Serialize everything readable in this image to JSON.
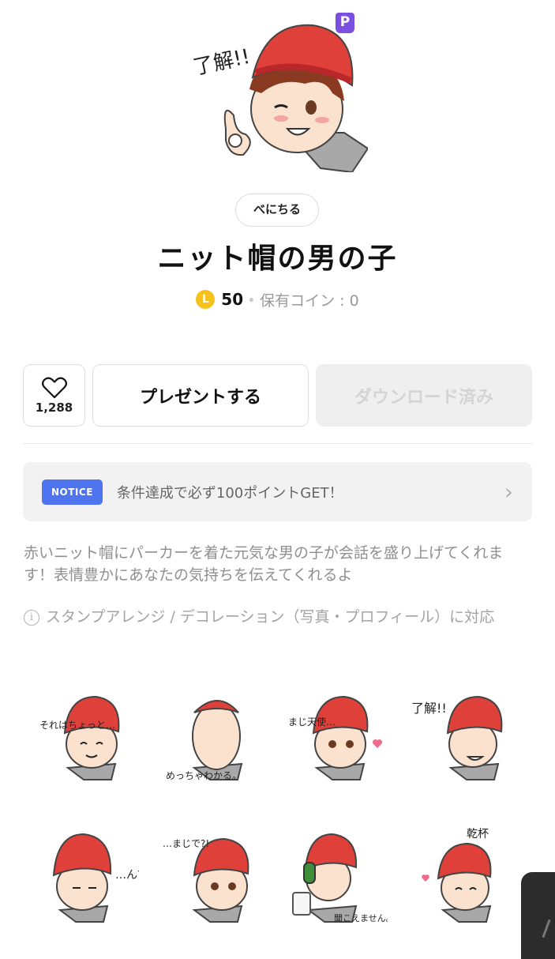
{
  "badge": "P",
  "creator": "べにちる",
  "title": "ニット帽の男の子",
  "price": {
    "coin_symbol": "L",
    "amount": "50",
    "owned": "保有コイン : 0"
  },
  "actions": {
    "like_count": "1,288",
    "present_label": "プレゼントする",
    "download_label": "ダウンロード済み"
  },
  "notice": {
    "badge": "NOTICE",
    "text": "条件達成で必ず100ポイントGET！"
  },
  "description": "赤いニット帽にパーカーを着た元気な男の子が会話を盛り上げてくれます！表情豊かにあなたの気持ちを伝えてくれるよ",
  "feature_note": "スタンプアレンジ / デコレーション（写真・プロフィール）に対応",
  "hero_text": "了解!!",
  "stickers": [
    {
      "text": "それはちょっと…"
    },
    {
      "text": "めっちゃわかる。"
    },
    {
      "text": "まじ天使…"
    },
    {
      "text": "了解!!"
    },
    {
      "text": "…ん?"
    },
    {
      "text": "…まじで?!"
    },
    {
      "text": "聞こえません。"
    },
    {
      "text": "乾杯"
    }
  ],
  "colors": {
    "hat": "#e0403a",
    "hair": "#8a3a20",
    "hoodie": "#9a9a9a",
    "notice_badge": "#4f74f0",
    "coin": "#f5c11a",
    "premium_badge": "#7b4fe0"
  }
}
